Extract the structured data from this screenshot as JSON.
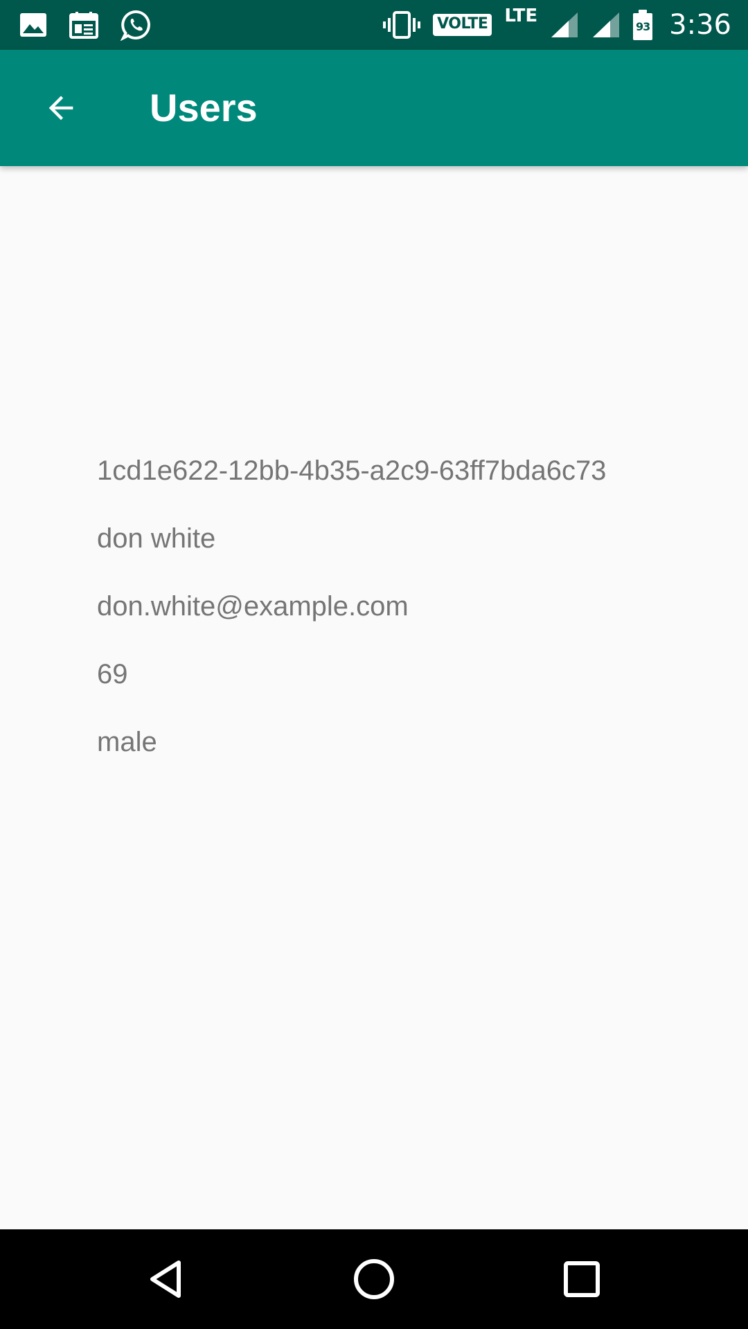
{
  "status_bar": {
    "left_icons": [
      "gallery-icon",
      "calendar-icon",
      "whatsapp-icon"
    ],
    "right_icons": [
      "vibrate-icon",
      "volte-icon",
      "lte-icon",
      "signal-icon",
      "signal-icon",
      "battery-icon"
    ],
    "volte_label": "VOLTE",
    "network_label": "LTE",
    "battery_level": "93",
    "time": "3:36"
  },
  "app_bar": {
    "nav_icon": "arrow-back-icon",
    "title": "Users"
  },
  "user": {
    "id": "1cd1e622-12bb-4b35-a2c9-63ff7bda6c73",
    "name": "don white",
    "email": "don.white@example.com",
    "age": "69",
    "gender": "male"
  },
  "nav_bar": {
    "buttons": [
      "back-triangle-icon",
      "home-circle-icon",
      "recents-square-icon"
    ]
  },
  "colors": {
    "status_bar": "#00574b",
    "app_bar": "#00897b",
    "background": "#fafafa",
    "body_text": "#757575",
    "nav_bar": "#000000"
  }
}
